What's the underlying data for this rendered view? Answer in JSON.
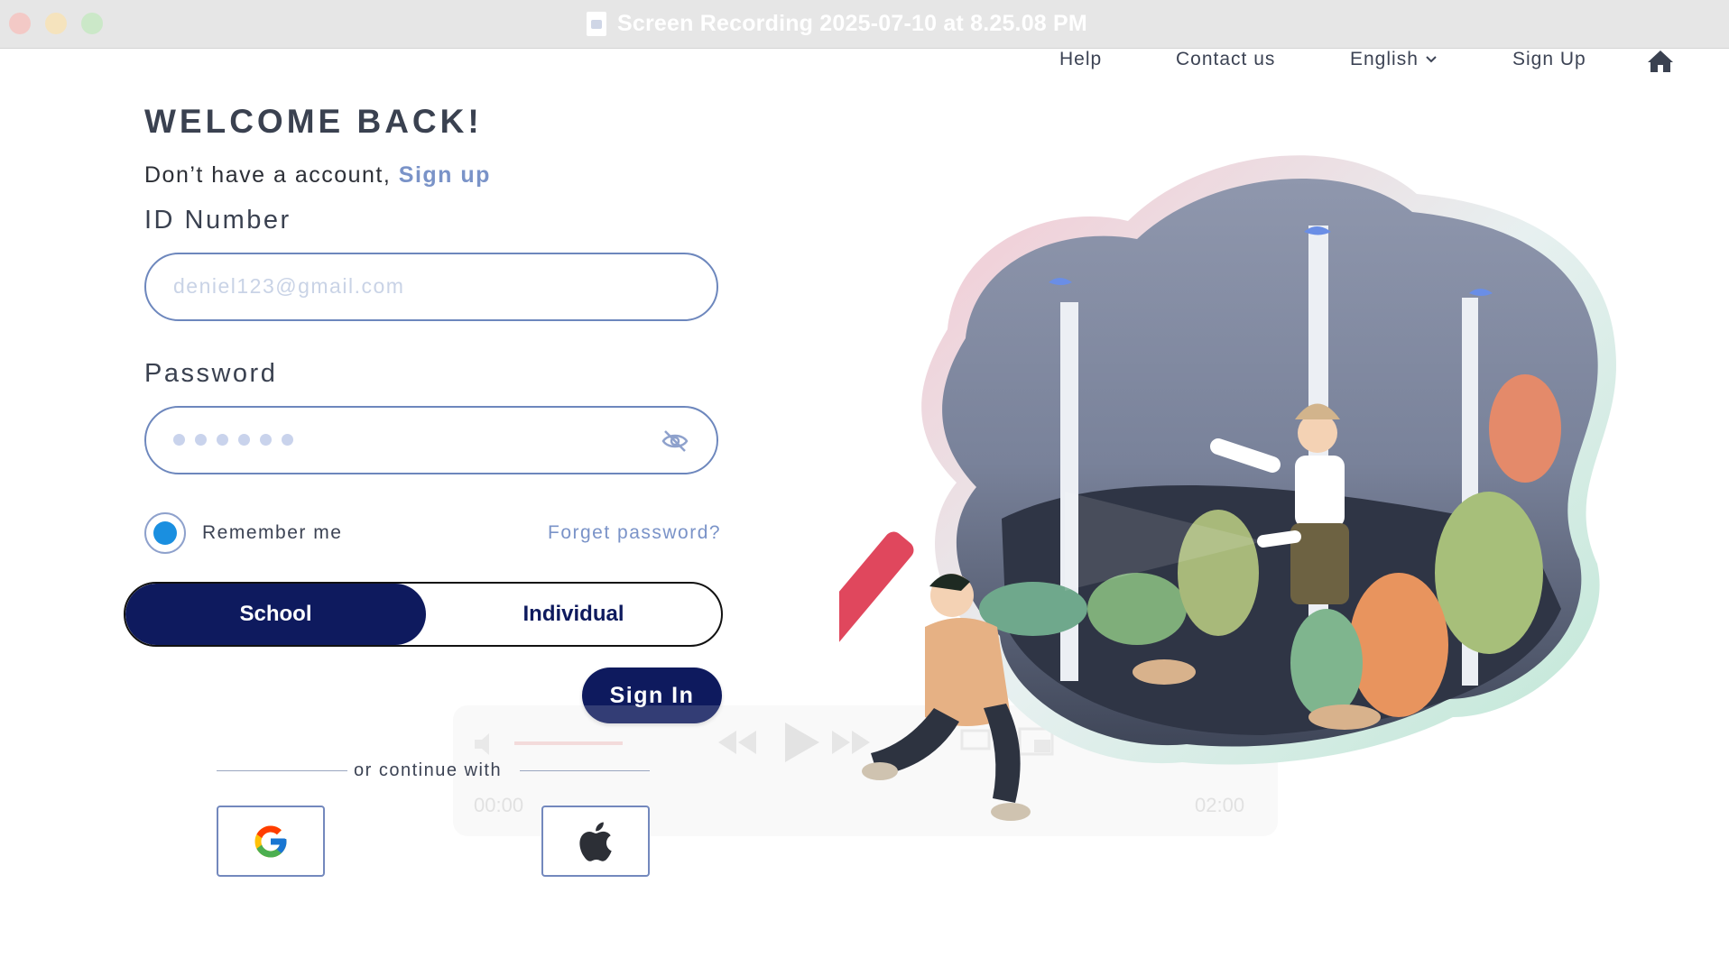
{
  "window": {
    "title": "Screen Recording 2025-07-10 at 8.25.08 PM"
  },
  "nav": {
    "help": "Help",
    "contact": "Contact us",
    "language": "English",
    "signup": "Sign Up",
    "home_icon": "home-icon"
  },
  "login": {
    "heading": "WELCOME BACK!",
    "no_account_text": "Don’t have a account,",
    "signup_link": "Sign up",
    "id_label": "ID Number",
    "id_placeholder": "deniel123@gmail.com",
    "password_label": "Password",
    "remember_label": "Remember me",
    "remember_checked": true,
    "forgot_link": "Forget password?",
    "toggle": {
      "options": [
        "School",
        "Individual"
      ],
      "selected": "School"
    },
    "signin_button": "Sign In",
    "or_continue": "or continue with",
    "social": [
      "google",
      "apple"
    ]
  },
  "video_controls": {
    "current_time": "00:00",
    "duration": "02:00"
  },
  "colors": {
    "primary": "#0e1a5e",
    "link": "#7a93c8",
    "field_border": "#6d87bd",
    "radio_fill": "#1a8fe0"
  }
}
